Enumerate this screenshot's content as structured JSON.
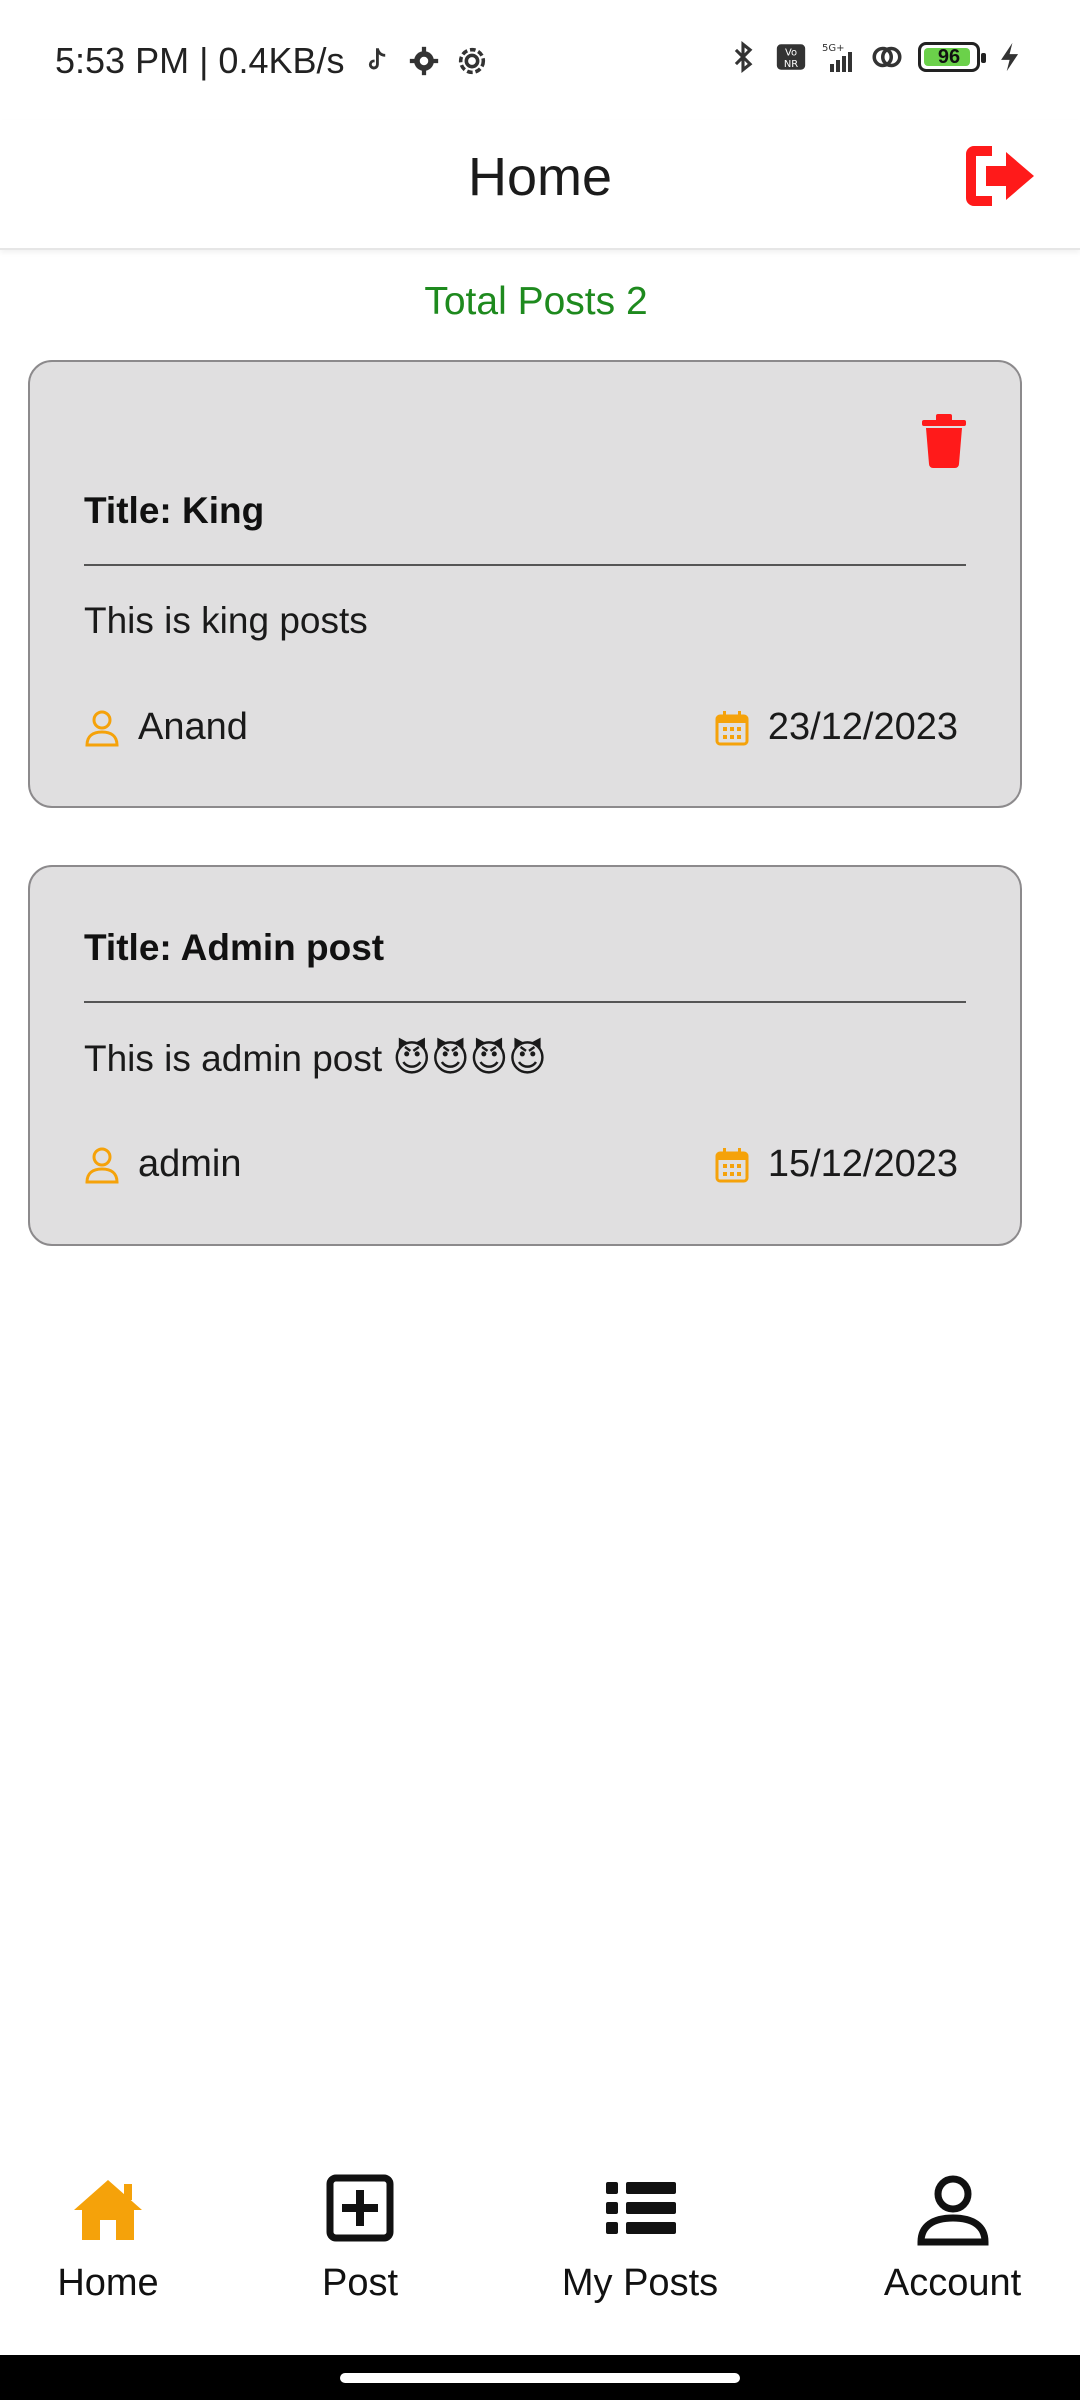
{
  "status_bar": {
    "time_speed": "5:53 PM | 0.4KB/s",
    "network_label": "5G+",
    "volte_label": "Vo NR",
    "battery_level": "96"
  },
  "header": {
    "title": "Home"
  },
  "summary": {
    "total_posts_text": "Total Posts 2"
  },
  "posts": [
    {
      "title": "Title: King",
      "body": "This is king posts",
      "author": "Anand",
      "date": "23/12/2023",
      "deletable": true
    },
    {
      "title": "Title: Admin post",
      "body": "This is admin post 😈😈😈😈",
      "author": "admin",
      "date": "15/12/2023",
      "deletable": false
    }
  ],
  "bottom_nav": {
    "items": [
      {
        "label": "Home",
        "icon": "home-icon",
        "active": true
      },
      {
        "label": "Post",
        "icon": "plus-square-icon",
        "active": false
      },
      {
        "label": "My Posts",
        "icon": "list-icon",
        "active": false
      },
      {
        "label": "Account",
        "icon": "user-icon",
        "active": false
      }
    ]
  },
  "colors": {
    "accent_orange": "#f5a20a",
    "danger_red": "#ff1a1a",
    "success_green": "#1e8a1e",
    "card_bg": "#e0dfe0"
  }
}
